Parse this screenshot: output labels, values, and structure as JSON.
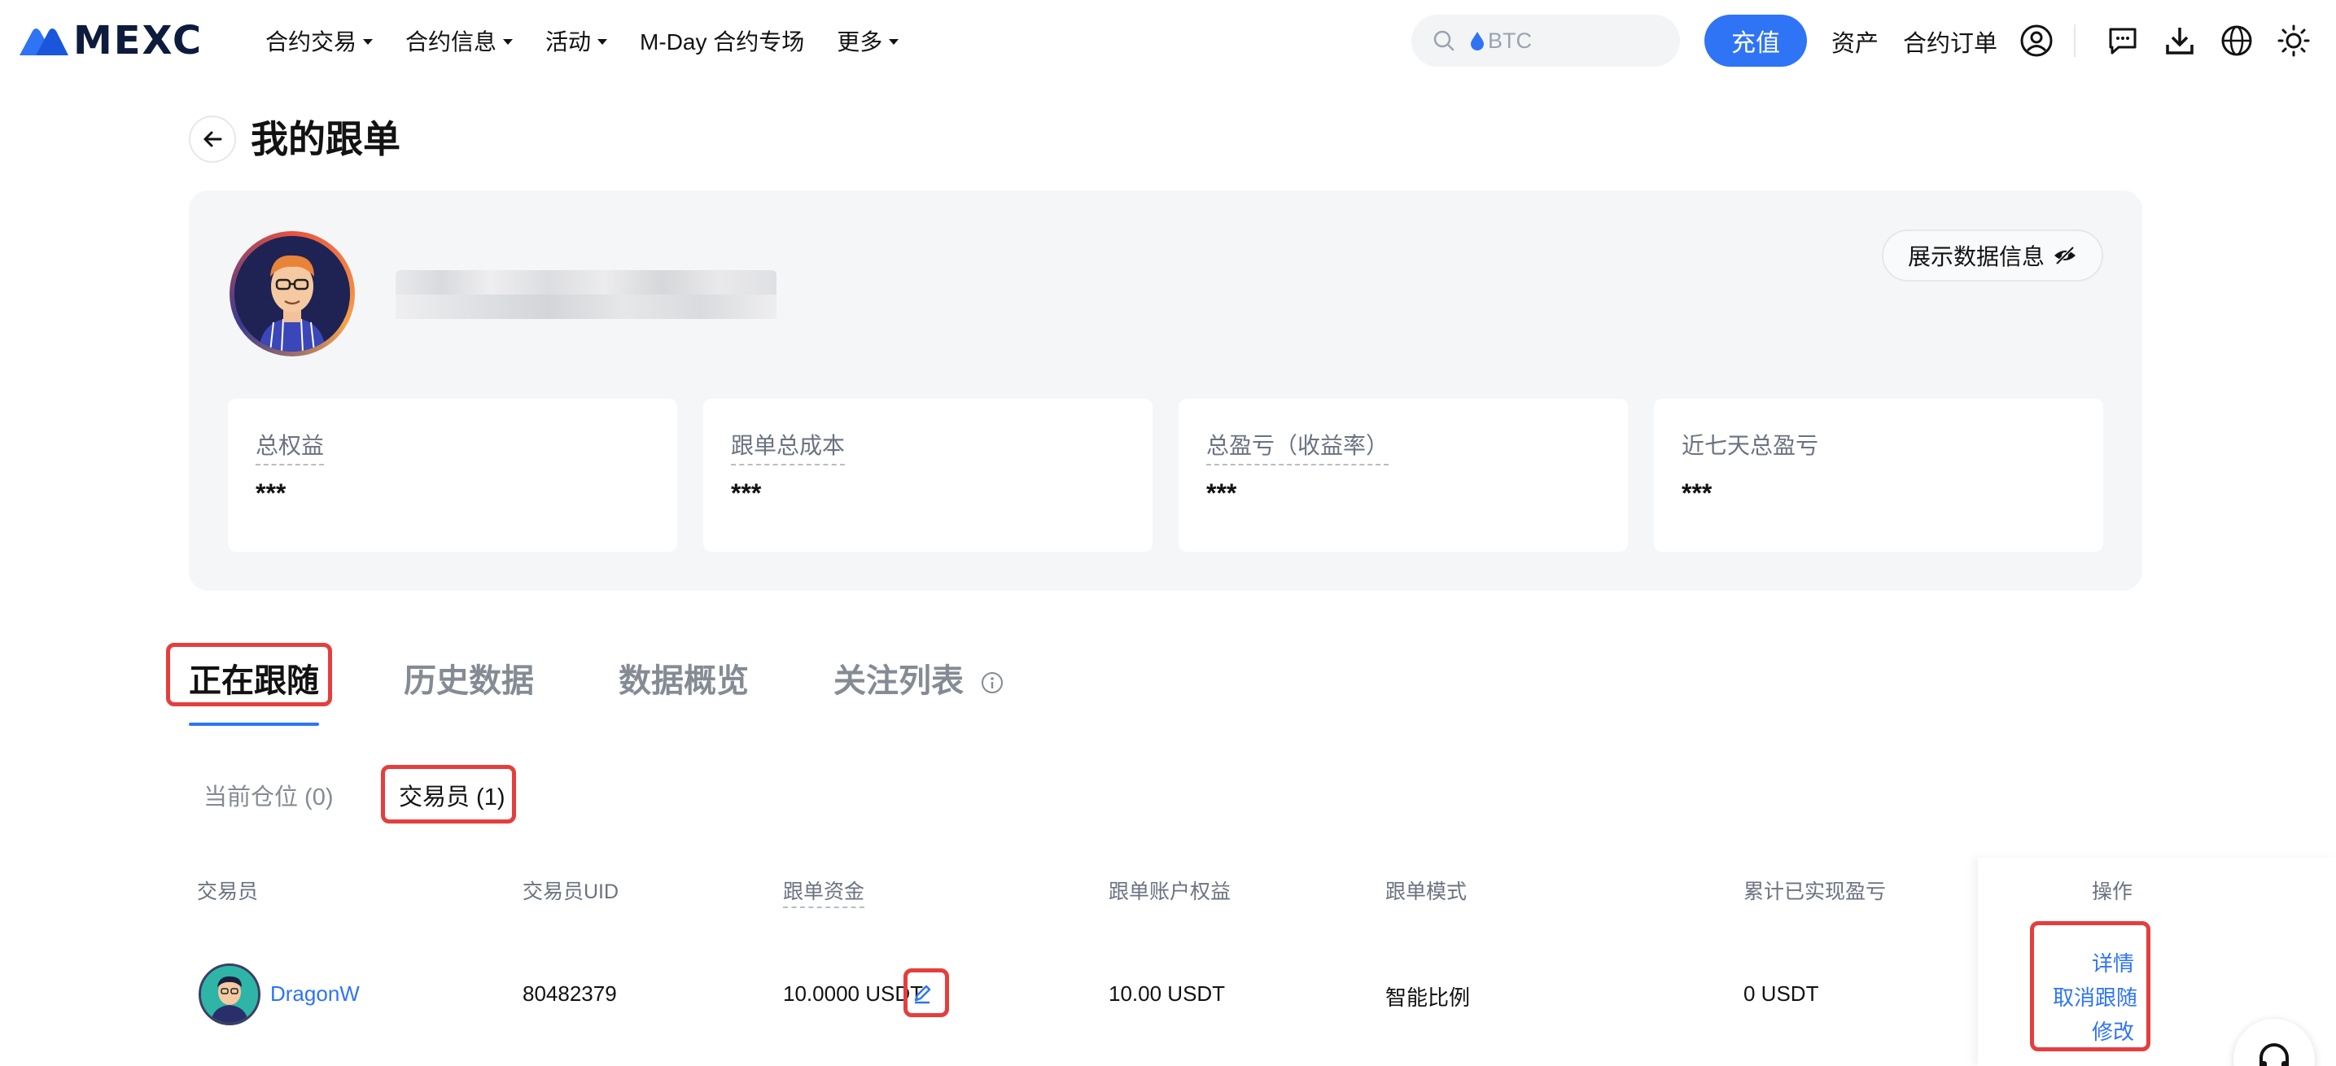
{
  "header": {
    "brand": "MEXC",
    "nav": [
      {
        "label": "合约交易",
        "dropdown": true
      },
      {
        "label": "合约信息",
        "dropdown": true
      },
      {
        "label": "活动",
        "dropdown": true
      },
      {
        "label": "M-Day 合约专场",
        "dropdown": false
      },
      {
        "label": "更多",
        "dropdown": true
      }
    ],
    "search_placeholder": "BTC",
    "deposit_label": "充值",
    "assets_label": "资产",
    "orders_label": "合约订单",
    "icons": [
      "user-icon",
      "message-icon",
      "download-icon",
      "globe-icon",
      "theme-icon"
    ]
  },
  "page": {
    "title": "我的跟单"
  },
  "overview": {
    "show_data_label": "展示数据信息",
    "stats": [
      {
        "label": "总权益",
        "value": "***"
      },
      {
        "label": "跟单总成本",
        "value": "***"
      },
      {
        "label": "总盈亏（收益率）",
        "value": "***"
      },
      {
        "label": "近七天总盈亏",
        "value": "***"
      }
    ]
  },
  "tabs": [
    {
      "label": "正在跟随",
      "active": true
    },
    {
      "label": "历史数据",
      "active": false
    },
    {
      "label": "数据概览",
      "active": false
    },
    {
      "label": "关注列表",
      "active": false
    }
  ],
  "subtabs": [
    {
      "label": "当前仓位 (0)",
      "active": false
    },
    {
      "label": "交易员 (1)",
      "active": true
    }
  ],
  "table": {
    "columns": [
      "交易员",
      "交易员UID",
      "跟单资金",
      "跟单账户权益",
      "跟单模式",
      "累计已实现盈亏",
      "操作"
    ],
    "rows": [
      {
        "trader": "DragonW",
        "uid": "80482379",
        "funds": "10.0000 USDT",
        "equity": "10.00 USDT",
        "mode": "智能比例",
        "realized_pnl": "0 USDT",
        "actions": [
          "详情",
          "取消跟随",
          "修改"
        ]
      }
    ]
  },
  "colors": {
    "accent": "#2f74f5",
    "highlight": "#e53e3e",
    "panel_bg": "#f5f6f8"
  }
}
